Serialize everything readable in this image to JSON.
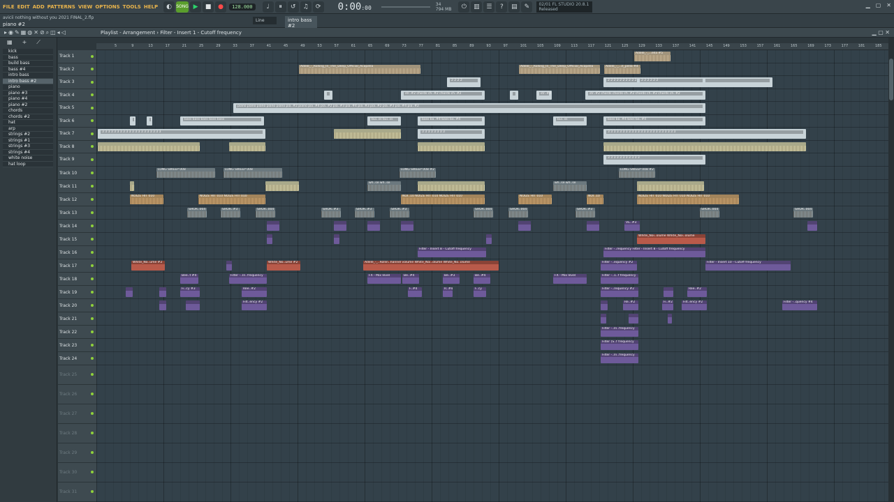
{
  "menu": [
    "FILE",
    "EDIT",
    "ADD",
    "PATTERNS",
    "VIEW",
    "OPTIONS",
    "TOOLS",
    "HELP"
  ],
  "transport": {
    "tempo": "128.000",
    "time_main": "0:00",
    "time_sub": ":00",
    "time_label": "M:S:CS"
  },
  "cpu": {
    "cpu_value": "34",
    "memory": "794 MB",
    "voices": "0"
  },
  "fl_version": "FL STUDIO 20.8.1",
  "fl_status": "Released",
  "fl_date": "02/01",
  "project": {
    "name": "avicii nothing without you 2021 FINAL_2.flp",
    "selected_channel": "piano #2"
  },
  "toolbar2": {
    "snap": "Line",
    "pattern": "intro bass #2"
  },
  "playlist": {
    "title": "Playlist - Arrangement",
    "breadcrumb": "Filter - Insert 1 - Cutoff frequency"
  },
  "channels": [
    "kick",
    "bass",
    "build bass",
    "bass #4",
    "intro bass",
    "intro bass #2",
    "piano",
    "piano #3",
    "piano #4",
    "piano #2",
    "chords",
    "chords #2",
    "hat",
    "arp",
    "strings #2",
    "strings #1",
    "strings #3",
    "strings #4",
    "white noise",
    "hat loop"
  ],
  "selected_channel_index": 5,
  "tracks": [
    "Track 1",
    "Track 2",
    "Track 3",
    "Track 4",
    "Track 5",
    "Track 6",
    "Track 7",
    "Track 8",
    "Track 9",
    "Track 10",
    "Track 11",
    "Track 12",
    "Track 13",
    "Track 14",
    "Track 15",
    "Track 16",
    "Track 17",
    "Track 18",
    "Track 19",
    "Track 20",
    "Track 21",
    "Track 22",
    "Track 23",
    "Track 24",
    "Track 25",
    "Track 26",
    "Track 27",
    "Track 28",
    "Track 29",
    "Track 30",
    "Track 31"
  ],
  "ruler_ticks": [
    "5",
    "9",
    "13",
    "17",
    "21",
    "25",
    "29",
    "33",
    "37",
    "41",
    "45",
    "49",
    "53",
    "57",
    "61",
    "65",
    "69",
    "73",
    "77",
    "81",
    "85",
    "89",
    "93",
    "97",
    "101",
    "105",
    "109",
    "113",
    "117",
    "121",
    "125",
    "129",
    "133",
    "137",
    "141",
    "145",
    "149",
    "153",
    "157",
    "161",
    "165",
    "169",
    "173",
    "177",
    "181",
    "185"
  ],
  "clips": [
    {
      "row": 0,
      "start": 770,
      "len": 52,
      "kind": "audio",
      "label": "Adele_-_...ella #5"
    },
    {
      "row": 1,
      "start": 290,
      "len": 174,
      "kind": "audio",
      "label": "Adele_-_Rolling_In_The_Deep_Official_Acapella"
    },
    {
      "row": 1,
      "start": 605,
      "len": 116,
      "kind": "audio",
      "label": "Adele_-_Rolling_In_The_Deep_Official_Acapella"
    },
    {
      "row": 1,
      "start": 727,
      "len": 52,
      "kind": "audio",
      "label": "Adele_-_...ll_pella #4"
    },
    {
      "row": 2,
      "start": 502,
      "len": 48,
      "kind": "pattern",
      "label": "2 2 2 2"
    },
    {
      "row": 2,
      "start": 726,
      "len": 242,
      "kind": "pattern",
      "label": "2 2 2 2 2 2 2 2 2 2 2 2 2 2 2 2 2 2 2 2"
    },
    {
      "row": 2,
      "start": 774,
      "len": 98,
      "kind": "pattern",
      "label": "2 2 2 2 2 2"
    },
    {
      "row": 3,
      "start": 326,
      "len": 12,
      "kind": "pattern",
      "label": ""
    },
    {
      "row": 3,
      "start": 436,
      "len": 120,
      "kind": "pattern",
      "label": "str..#2 chords ch..#2 chords ch..#2"
    },
    {
      "row": 3,
      "start": 592,
      "len": 12,
      "kind": "pattern",
      "label": ""
    },
    {
      "row": 3,
      "start": 630,
      "len": 22,
      "kind": "pattern",
      "label": "str..#4"
    },
    {
      "row": 3,
      "start": 700,
      "len": 172,
      "kind": "pattern",
      "label": "str..#2 chords chords ch..#2 chords ch..#2 chords ch..#2"
    },
    {
      "row": 4,
      "start": 196,
      "len": 676,
      "kind": "pattern",
      "label": "piano piano piano piano piano pia..#2 piano pia..#4 pia..#2 pia..#3 pia..#4 pia..#3 pia..#2 pia..#3 pia..#4 pia..#2"
    },
    {
      "row": 5,
      "start": 48,
      "len": 4,
      "kind": "pattern",
      "label": "3"
    },
    {
      "row": 5,
      "start": 72,
      "len": 4,
      "kind": "pattern",
      "label": "3"
    },
    {
      "row": 5,
      "start": 120,
      "len": 120,
      "kind": "pattern",
      "label": "bass bass bass bass bass"
    },
    {
      "row": 5,
      "start": 388,
      "len": 48,
      "kind": "pattern",
      "label": "bui..ss bui..ss"
    },
    {
      "row": 5,
      "start": 460,
      "len": 96,
      "kind": "pattern",
      "label": "bass ba..#4 bass ba..#4"
    },
    {
      "row": 5,
      "start": 654,
      "len": 48,
      "kind": "pattern",
      "label": "bui..ss"
    },
    {
      "row": 5,
      "start": 726,
      "len": 146,
      "kind": "pattern",
      "label": "bass ba..#4 bass ba..#4"
    },
    {
      "row": 6,
      "start": 2,
      "len": 240,
      "kind": "pattern",
      "label": "3 3 3 3 3 3 3 3 3 3 3 3 3 3 3 3 3 3 3 3"
    },
    {
      "row": 6,
      "start": 340,
      "len": 96,
      "kind": "synth",
      "label": ""
    },
    {
      "row": 6,
      "start": 460,
      "len": 96,
      "kind": "pattern",
      "label": "3 3 3 3 3 3 3 3"
    },
    {
      "row": 6,
      "start": 726,
      "len": 290,
      "kind": "pattern",
      "label": "3 3 3 3 3 3 3 3 3 3 3 3 3 3 3 3 3 3 3 3 3 3 3"
    },
    {
      "row": 7,
      "start": 2,
      "len": 146,
      "kind": "synth",
      "label": ""
    },
    {
      "row": 7,
      "start": 190,
      "len": 52,
      "kind": "synth",
      "label": ""
    },
    {
      "row": 7,
      "start": 460,
      "len": 96,
      "kind": "synth",
      "label": ""
    },
    {
      "row": 7,
      "start": 726,
      "len": 290,
      "kind": "synth",
      "label": ""
    },
    {
      "row": 8,
      "start": 726,
      "len": 146,
      "kind": "pattern",
      "label": "3 3 3 3 3 3 3 3 3 3 3"
    },
    {
      "row": 9,
      "start": 86,
      "len": 84,
      "kind": "sweep",
      "label": "LONG SWEEP 008"
    },
    {
      "row": 9,
      "start": 182,
      "len": 84,
      "kind": "sweep",
      "label": "LONG SWEEP 008"
    },
    {
      "row": 9,
      "start": 434,
      "len": 52,
      "kind": "sweep",
      "label": "LONG SWEEP 008 #2"
    },
    {
      "row": 9,
      "start": 748,
      "len": 52,
      "kind": "sweep",
      "label": "LONG SWEEP 008 #2"
    },
    {
      "row": 10,
      "start": 48,
      "len": 6,
      "kind": "synth",
      "label": ""
    },
    {
      "row": 10,
      "start": 242,
      "len": 48,
      "kind": "synth",
      "label": ""
    },
    {
      "row": 10,
      "start": 388,
      "len": 48,
      "kind": "sweep",
      "label": "wh..se wh..se"
    },
    {
      "row": 10,
      "start": 460,
      "len": 96,
      "kind": "synth",
      "label": ""
    },
    {
      "row": 10,
      "start": 654,
      "len": 48,
      "kind": "sweep",
      "label": "wh..se wh..se"
    },
    {
      "row": 10,
      "start": 774,
      "len": 96,
      "kind": "synth",
      "label": ""
    },
    {
      "row": 11,
      "start": 48,
      "len": 48,
      "kind": "noise",
      "label": "NOIZE HIT 010"
    },
    {
      "row": 11,
      "start": 146,
      "len": 96,
      "kind": "noise",
      "label": "NOIZE HIT 010 NOIZE HIT 010"
    },
    {
      "row": 11,
      "start": 436,
      "len": 120,
      "kind": "noise",
      "label": "NOI..10 NOIZE HIT 010 NOIZE HIT 010"
    },
    {
      "row": 11,
      "start": 604,
      "len": 48,
      "kind": "noise",
      "label": "NOIZE HIT 010"
    },
    {
      "row": 11,
      "start": 702,
      "len": 24,
      "kind": "noise",
      "label": "NOI..10"
    },
    {
      "row": 11,
      "start": 774,
      "len": 146,
      "kind": "noise",
      "label": "NOIZE HIT 010 NOIZE HIT 010 NOIZE HIT 010"
    },
    {
      "row": 12,
      "start": 130,
      "len": 28,
      "kind": "sweep",
      "label": "SHOR..004"
    },
    {
      "row": 12,
      "start": 178,
      "len": 28,
      "kind": "sweep",
      "label": "SHOR..#3"
    },
    {
      "row": 12,
      "start": 228,
      "len": 28,
      "kind": "sweep",
      "label": "SHOR..004"
    },
    {
      "row": 12,
      "start": 322,
      "len": 28,
      "kind": "sweep",
      "label": "SHOR..#3"
    },
    {
      "row": 12,
      "start": 370,
      "len": 28,
      "kind": "sweep",
      "label": "SHOR..#3"
    },
    {
      "row": 12,
      "start": 420,
      "len": 28,
      "kind": "sweep",
      "label": "SHOR..#3"
    },
    {
      "row": 12,
      "start": 540,
      "len": 28,
      "kind": "sweep",
      "label": "SHOR..004"
    },
    {
      "row": 12,
      "start": 590,
      "len": 28,
      "kind": "sweep",
      "label": "SHOR..004"
    },
    {
      "row": 12,
      "start": 686,
      "len": 28,
      "kind": "sweep",
      "label": "SHOR..#3"
    },
    {
      "row": 12,
      "start": 864,
      "len": 28,
      "kind": "sweep",
      "label": "SHOR..004"
    },
    {
      "row": 12,
      "start": 998,
      "len": 28,
      "kind": "sweep",
      "label": "SHOR..004"
    },
    {
      "row": 13,
      "start": 244,
      "len": 18,
      "kind": "auto",
      "label": ""
    },
    {
      "row": 13,
      "start": 340,
      "len": 18,
      "kind": "auto",
      "label": ""
    },
    {
      "row": 13,
      "start": 388,
      "len": 18,
      "kind": "auto",
      "label": ""
    },
    {
      "row": 13,
      "start": 436,
      "len": 18,
      "kind": "auto",
      "label": ""
    },
    {
      "row": 13,
      "start": 604,
      "len": 18,
      "kind": "auto",
      "label": ""
    },
    {
      "row": 13,
      "start": 702,
      "len": 18,
      "kind": "auto",
      "label": ""
    },
    {
      "row": 13,
      "start": 756,
      "len": 22,
      "kind": "auto",
      "label": "VE..#3"
    },
    {
      "row": 13,
      "start": 1018,
      "len": 14,
      "kind": "auto",
      "label": ""
    },
    {
      "row": 14,
      "start": 244,
      "len": 8,
      "kind": "auto",
      "label": ""
    },
    {
      "row": 14,
      "start": 340,
      "len": 8,
      "kind": "auto",
      "label": ""
    },
    {
      "row": 14,
      "start": 558,
      "len": 8,
      "kind": "auto",
      "label": ""
    },
    {
      "row": 14,
      "start": 774,
      "len": 98,
      "kind": "fx",
      "label": "White_Noi..olume White_Noi..olume"
    },
    {
      "row": 15,
      "start": 460,
      "len": 98,
      "kind": "auto",
      "label": "Filter - Insert 8 - Cutoff frequency"
    },
    {
      "row": 15,
      "start": 726,
      "len": 146,
      "kind": "auto",
      "label": "Filter -..requency Filter - Insert 8 - Cutoff frequency"
    },
    {
      "row": 16,
      "start": 50,
      "len": 48,
      "kind": "fx",
      "label": "White_No..ume #2"
    },
    {
      "row": 16,
      "start": 186,
      "len": 8,
      "kind": "auto",
      "label": ""
    },
    {
      "row": 16,
      "start": 244,
      "len": 48,
      "kind": "fx",
      "label": "White_No..ume #2"
    },
    {
      "row": 16,
      "start": 382,
      "len": 194,
      "kind": "fx",
      "label": "Adele_-_..Rollin..hannel volume White_Noi..olume White_No..olume"
    },
    {
      "row": 16,
      "start": 722,
      "len": 52,
      "kind": "auto",
      "label": "Filter -..equency #2"
    },
    {
      "row": 16,
      "start": 872,
      "len": 122,
      "kind": "auto",
      "label": "Filter - Insert 10 - Cutoff frequency"
    },
    {
      "row": 17,
      "start": 120,
      "len": 26,
      "kind": "auto",
      "label": "Bee..t #4"
    },
    {
      "row": 17,
      "start": 190,
      "len": 54,
      "kind": "auto",
      "label": "Filter -..In..frequency"
    },
    {
      "row": 17,
      "start": 388,
      "len": 48,
      "kind": "auto",
      "label": "FX - Mix level"
    },
    {
      "row": 17,
      "start": 438,
      "len": 24,
      "kind": "auto",
      "label": "Be..#4"
    },
    {
      "row": 17,
      "start": 496,
      "len": 24,
      "kind": "auto",
      "label": "Be..#3"
    },
    {
      "row": 17,
      "start": 540,
      "len": 24,
      "kind": "auto",
      "label": "Be..#4"
    },
    {
      "row": 17,
      "start": 654,
      "len": 48,
      "kind": "auto",
      "label": "FX - Mix level"
    },
    {
      "row": 17,
      "start": 722,
      "len": 54,
      "kind": "auto",
      "label": "Filter -..1..f frequency"
    },
    {
      "row": 18,
      "start": 42,
      "len": 10,
      "kind": "auto",
      "label": ""
    },
    {
      "row": 18,
      "start": 90,
      "len": 10,
      "kind": "auto",
      "label": ""
    },
    {
      "row": 18,
      "start": 120,
      "len": 28,
      "kind": "auto",
      "label": "Fi..cy #3"
    },
    {
      "row": 18,
      "start": 208,
      "len": 36,
      "kind": "auto",
      "label": "Ree..#2"
    },
    {
      "row": 18,
      "start": 446,
      "len": 20,
      "kind": "auto",
      "label": "F..#4"
    },
    {
      "row": 18,
      "start": 496,
      "len": 14,
      "kind": "auto",
      "label": "R..#4"
    },
    {
      "row": 18,
      "start": 540,
      "len": 18,
      "kind": "auto",
      "label": "F..cy"
    },
    {
      "row": 18,
      "start": 722,
      "len": 54,
      "kind": "auto",
      "label": "Filter -..requency #2"
    },
    {
      "row": 18,
      "start": 812,
      "len": 14,
      "kind": "auto",
      "label": ""
    },
    {
      "row": 18,
      "start": 846,
      "len": 28,
      "kind": "auto",
      "label": "Ree..#2"
    },
    {
      "row": 19,
      "start": 90,
      "len": 10,
      "kind": "auto",
      "label": ""
    },
    {
      "row": 19,
      "start": 128,
      "len": 20,
      "kind": "auto",
      "label": ""
    },
    {
      "row": 19,
      "start": 208,
      "len": 36,
      "kind": "auto",
      "label": "Filt..ency #2"
    },
    {
      "row": 19,
      "start": 722,
      "len": 10,
      "kind": "auto",
      "label": ""
    },
    {
      "row": 19,
      "start": 754,
      "len": 22,
      "kind": "auto",
      "label": "Re..#2"
    },
    {
      "row": 19,
      "start": 810,
      "len": 16,
      "kind": "auto",
      "label": "Fi..#2"
    },
    {
      "row": 19,
      "start": 838,
      "len": 36,
      "kind": "auto",
      "label": "Filt..ency #2"
    },
    {
      "row": 19,
      "start": 982,
      "len": 50,
      "kind": "auto",
      "label": "Filter -..quency #4"
    },
    {
      "row": 20,
      "start": 722,
      "len": 8,
      "kind": "auto",
      "label": ""
    },
    {
      "row": 20,
      "start": 762,
      "len": 14,
      "kind": "auto",
      "label": ""
    },
    {
      "row": 20,
      "start": 818,
      "len": 6,
      "kind": "auto",
      "label": ""
    },
    {
      "row": 21,
      "start": 722,
      "len": 54,
      "kind": "auto",
      "label": "Filter -..In..frequency"
    },
    {
      "row": 22,
      "start": 722,
      "len": 54,
      "kind": "auto",
      "label": "Filter (S..f frequency"
    },
    {
      "row": 23,
      "start": 722,
      "len": 54,
      "kind": "auto",
      "label": "Filter -..In..frequency"
    }
  ]
}
